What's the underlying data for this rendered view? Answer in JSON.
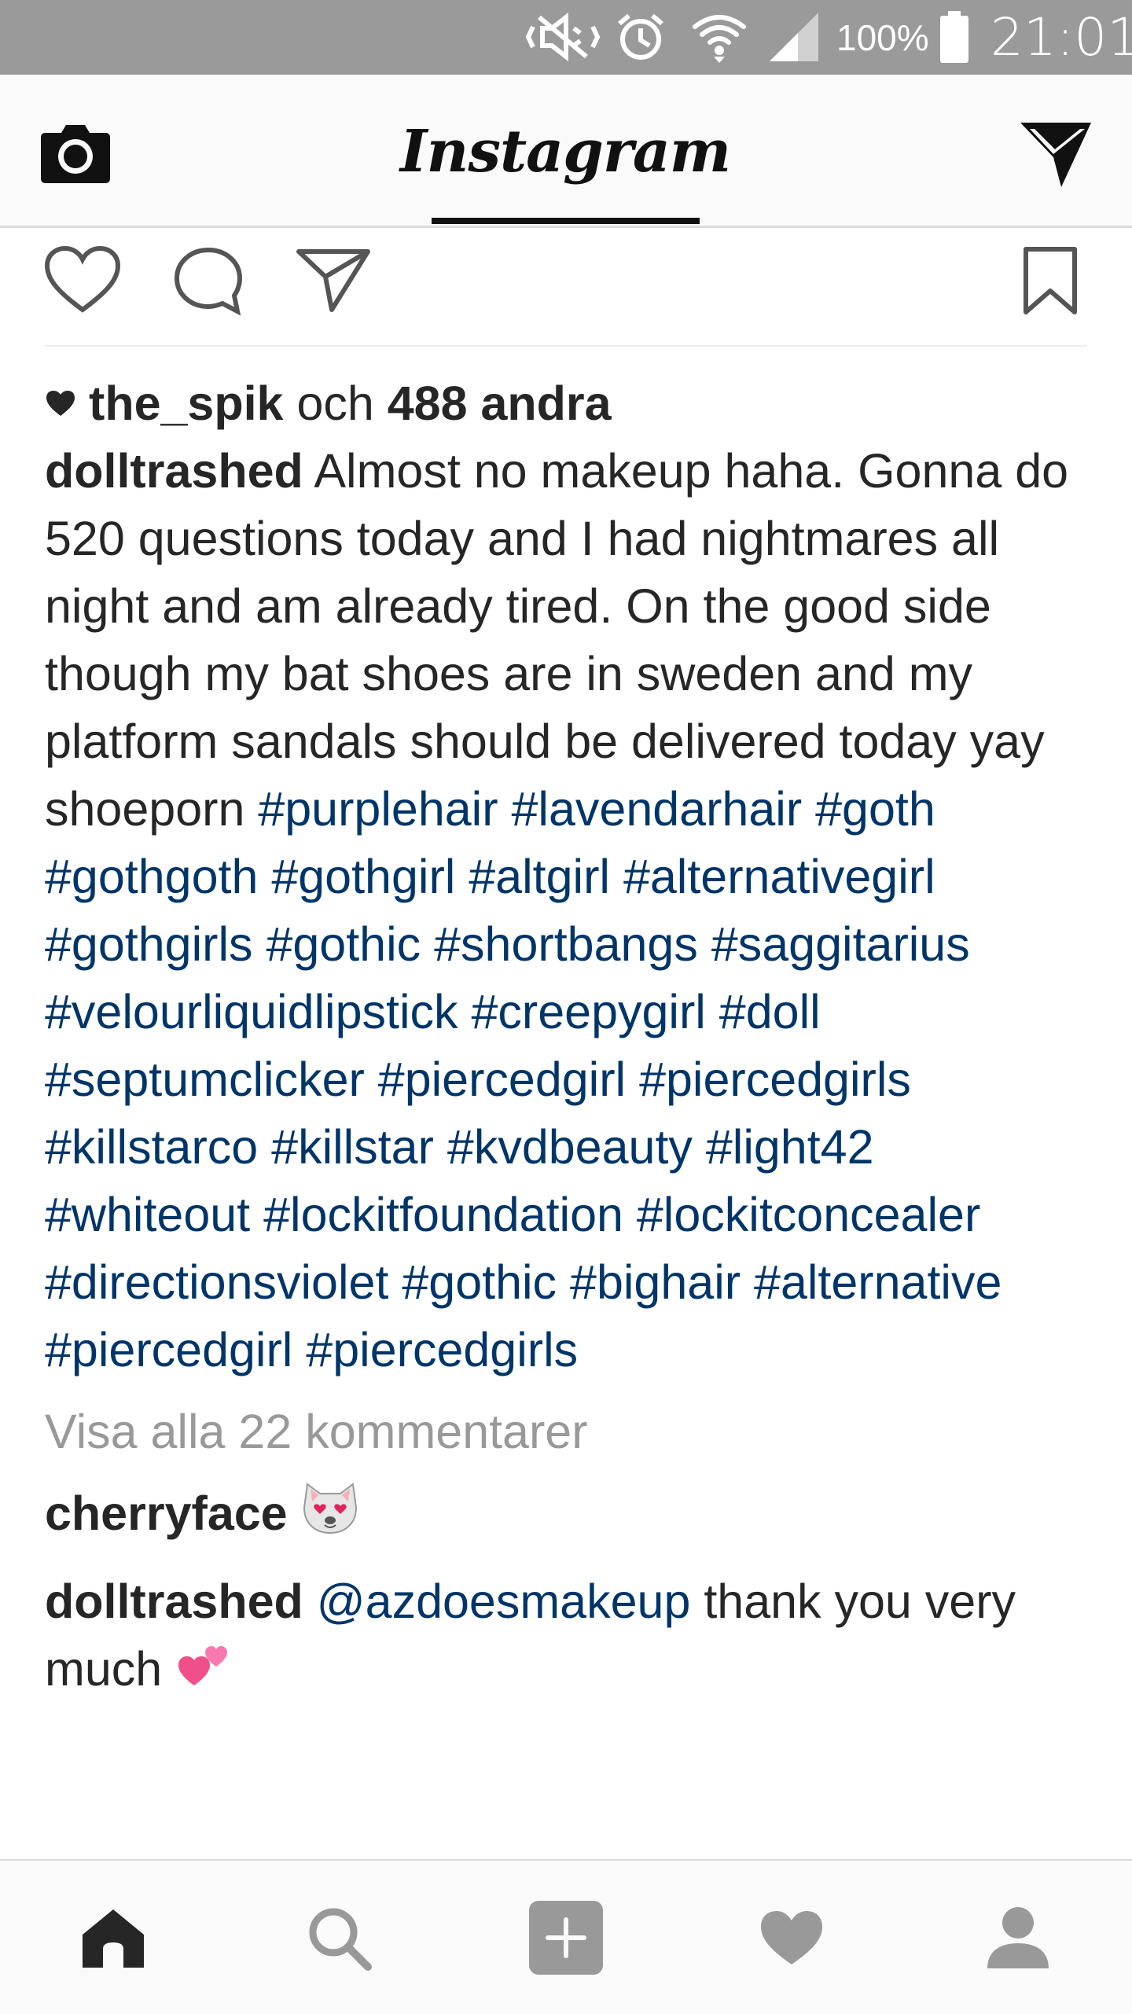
{
  "status_bar": {
    "battery_percent": "100%",
    "time": "21:01",
    "icons": [
      "mute-vibrate-icon",
      "alarm-icon",
      "wifi-icon",
      "signal-icon",
      "battery-icon"
    ]
  },
  "header": {
    "logo_text": "Instagram",
    "left_icon": "camera-icon",
    "right_icon": "direct-send-icon"
  },
  "post": {
    "actions": [
      "heart-icon",
      "comment-icon",
      "share-icon",
      "bookmark-icon"
    ],
    "likes": {
      "user": "the_spik",
      "middle": " och ",
      "count": "488 andra"
    },
    "caption": {
      "author": "dolltrashed",
      "text": " Almost no makeup haha. Gonna do 520 questions today and I had nightmares all night and am already tired. On the good side though my bat shoes are in sweden and my platform sandals should be delivered today yay shoeporn ",
      "hashtags": [
        "#purplehair",
        "#lavendarhair",
        "#goth",
        "#gothgoth",
        "#gothgirl",
        "#altgirl",
        "#alternativegirl",
        "#gothgirls",
        "#gothic",
        "#shortbangs",
        "#saggitarius",
        "#velourliquidlipstick",
        "#creepygirl",
        "#doll",
        "#septumclicker",
        "#piercedgirl",
        "#piercedgirls",
        "#killstarco",
        "#killstar",
        "#kvdbeauty",
        "#light42",
        "#whiteout",
        "#lockitfoundation",
        "#lockitconcealer",
        "#directionsviolet",
        "#gothic",
        "#bighair",
        "#alternative",
        "#piercedgirl",
        "#piercedgirls"
      ]
    },
    "view_all_comments": "Visa alla 22 kommentarer",
    "comments": [
      {
        "user": "cherryface",
        "text": " ",
        "emoji": "cat-heart-eyes-emoji"
      },
      {
        "user": "dolltrashed",
        "mention": "@azdoesmakeup",
        "text": " thank you very much ",
        "emoji": "two-hearts-emoji"
      }
    ]
  },
  "bottom_nav": {
    "items": [
      "home-icon",
      "search-icon",
      "add-post-icon",
      "activity-heart-icon",
      "profile-icon"
    ],
    "active": "home-icon"
  },
  "colors": {
    "status_bar": "#9a9a9a",
    "hashtag": "#003569",
    "muted_text": "#999999",
    "text": "#262626"
  }
}
